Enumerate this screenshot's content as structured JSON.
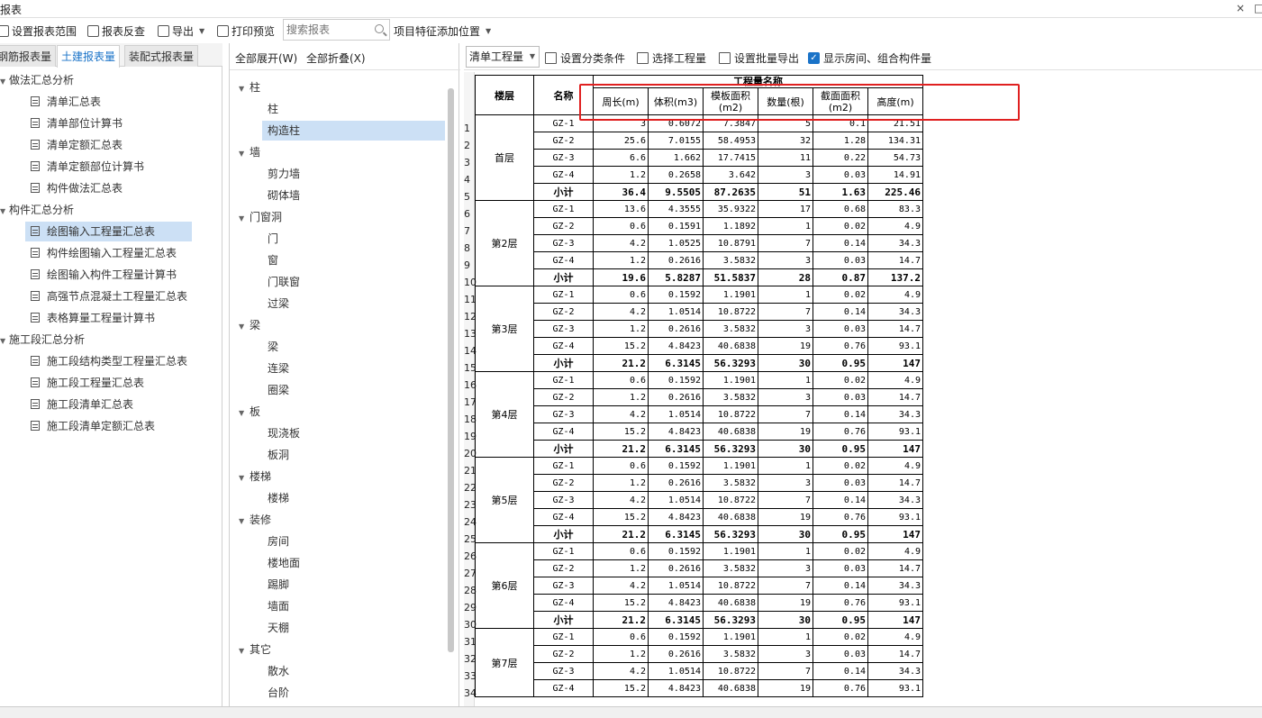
{
  "window": {
    "title": "报表",
    "close_glyph": "×",
    "restore_glyph": "□"
  },
  "toolbar": {
    "set_range": "设置报表范围",
    "reverse": "报表反查",
    "export": "导出",
    "print_preview": "打印预览",
    "search_placeholder": "搜索报表",
    "add_feature_position": "项目特征添加位置"
  },
  "left_tabs": [
    "钢筋报表量",
    "土建报表量",
    "装配式报表量"
  ],
  "left_tree": [
    {
      "type": "group",
      "label": "做法汇总分析"
    },
    {
      "type": "item",
      "label": "清单汇总表"
    },
    {
      "type": "item",
      "label": "清单部位计算书"
    },
    {
      "type": "item",
      "label": "清单定额汇总表"
    },
    {
      "type": "item",
      "label": "清单定额部位计算书"
    },
    {
      "type": "item",
      "label": "构件做法汇总表"
    },
    {
      "type": "group",
      "label": "构件汇总分析"
    },
    {
      "type": "item",
      "label": "绘图输入工程量汇总表",
      "selected": true
    },
    {
      "type": "item",
      "label": "构件绘图输入工程量汇总表"
    },
    {
      "type": "item",
      "label": "绘图输入构件工程量计算书"
    },
    {
      "type": "item",
      "label": "高强节点混凝土工程量汇总表"
    },
    {
      "type": "item",
      "label": "表格算量工程量计算书"
    },
    {
      "type": "group",
      "label": "施工段汇总分析"
    },
    {
      "type": "item",
      "label": "施工段结构类型工程量汇总表"
    },
    {
      "type": "item",
      "label": "施工段工程量汇总表"
    },
    {
      "type": "item",
      "label": "施工段清单汇总表"
    },
    {
      "type": "item",
      "label": "施工段清单定额汇总表"
    }
  ],
  "mid_head": {
    "expand_all": "全部展开(W)",
    "collapse_all": "全部折叠(X)"
  },
  "mid_tree": [
    {
      "type": "group",
      "label": "柱"
    },
    {
      "type": "item",
      "label": "柱"
    },
    {
      "type": "item",
      "label": "构造柱",
      "selected": true
    },
    {
      "type": "group",
      "label": "墙"
    },
    {
      "type": "item",
      "label": "剪力墙"
    },
    {
      "type": "item",
      "label": "砌体墙"
    },
    {
      "type": "group",
      "label": "门窗洞"
    },
    {
      "type": "item",
      "label": "门"
    },
    {
      "type": "item",
      "label": "窗"
    },
    {
      "type": "item",
      "label": "门联窗"
    },
    {
      "type": "item",
      "label": "过梁"
    },
    {
      "type": "group",
      "label": "梁"
    },
    {
      "type": "item",
      "label": "梁"
    },
    {
      "type": "item",
      "label": "连梁"
    },
    {
      "type": "item",
      "label": "圈梁"
    },
    {
      "type": "group",
      "label": "板"
    },
    {
      "type": "item",
      "label": "现浇板"
    },
    {
      "type": "item",
      "label": "板洞"
    },
    {
      "type": "group",
      "label": "楼梯"
    },
    {
      "type": "item",
      "label": "楼梯"
    },
    {
      "type": "group",
      "label": "装修"
    },
    {
      "type": "item",
      "label": "房间"
    },
    {
      "type": "item",
      "label": "楼地面"
    },
    {
      "type": "item",
      "label": "踢脚"
    },
    {
      "type": "item",
      "label": "墙面"
    },
    {
      "type": "item",
      "label": "天棚"
    },
    {
      "type": "group",
      "label": "其它"
    },
    {
      "type": "item",
      "label": "散水"
    },
    {
      "type": "item",
      "label": "台阶"
    }
  ],
  "right_toolbar": {
    "filter_value": "清单工程量",
    "set_category": "设置分类条件",
    "select_project": "选择工程量",
    "batch_export": "设置批量导出",
    "show_rooms": "显示房间、组合构件量"
  },
  "table": {
    "head": {
      "floor": "楼层",
      "name": "名称",
      "group": "工程量名称",
      "cols": [
        "周长(m)",
        "体积(m3)",
        "模板面积(m2)",
        "数量(根)",
        "截面面积(m2)",
        "高度(m)"
      ]
    },
    "floors": [
      {
        "floor": "首层",
        "rows": [
          [
            "GZ-1",
            "3",
            "0.6072",
            "7.3847",
            "5",
            "0.1",
            "21.51"
          ],
          [
            "GZ-2",
            "25.6",
            "7.0155",
            "58.4953",
            "32",
            "1.28",
            "134.31"
          ],
          [
            "GZ-3",
            "6.6",
            "1.662",
            "17.7415",
            "11",
            "0.22",
            "54.73"
          ],
          [
            "GZ-4",
            "1.2",
            "0.2658",
            "3.642",
            "3",
            "0.03",
            "14.91"
          ],
          [
            "小计",
            "36.4",
            "9.5505",
            "87.2635",
            "51",
            "1.63",
            "225.46"
          ]
        ]
      },
      {
        "floor": "第2层",
        "rows": [
          [
            "GZ-1",
            "13.6",
            "4.3555",
            "35.9322",
            "17",
            "0.68",
            "83.3"
          ],
          [
            "GZ-2",
            "0.6",
            "0.1591",
            "1.1892",
            "1",
            "0.02",
            "4.9"
          ],
          [
            "GZ-3",
            "4.2",
            "1.0525",
            "10.8791",
            "7",
            "0.14",
            "34.3"
          ],
          [
            "GZ-4",
            "1.2",
            "0.2616",
            "3.5832",
            "3",
            "0.03",
            "14.7"
          ],
          [
            "小计",
            "19.6",
            "5.8287",
            "51.5837",
            "28",
            "0.87",
            "137.2"
          ]
        ]
      },
      {
        "floor": "第3层",
        "rows": [
          [
            "GZ-1",
            "0.6",
            "0.1592",
            "1.1901",
            "1",
            "0.02",
            "4.9"
          ],
          [
            "GZ-2",
            "4.2",
            "1.0514",
            "10.8722",
            "7",
            "0.14",
            "34.3"
          ],
          [
            "GZ-3",
            "1.2",
            "0.2616",
            "3.5832",
            "3",
            "0.03",
            "14.7"
          ],
          [
            "GZ-4",
            "15.2",
            "4.8423",
            "40.6838",
            "19",
            "0.76",
            "93.1"
          ],
          [
            "小计",
            "21.2",
            "6.3145",
            "56.3293",
            "30",
            "0.95",
            "147"
          ]
        ]
      },
      {
        "floor": "第4层",
        "rows": [
          [
            "GZ-1",
            "0.6",
            "0.1592",
            "1.1901",
            "1",
            "0.02",
            "4.9"
          ],
          [
            "GZ-2",
            "1.2",
            "0.2616",
            "3.5832",
            "3",
            "0.03",
            "14.7"
          ],
          [
            "GZ-3",
            "4.2",
            "1.0514",
            "10.8722",
            "7",
            "0.14",
            "34.3"
          ],
          [
            "GZ-4",
            "15.2",
            "4.8423",
            "40.6838",
            "19",
            "0.76",
            "93.1"
          ],
          [
            "小计",
            "21.2",
            "6.3145",
            "56.3293",
            "30",
            "0.95",
            "147"
          ]
        ]
      },
      {
        "floor": "第5层",
        "rows": [
          [
            "GZ-1",
            "0.6",
            "0.1592",
            "1.1901",
            "1",
            "0.02",
            "4.9"
          ],
          [
            "GZ-2",
            "1.2",
            "0.2616",
            "3.5832",
            "3",
            "0.03",
            "14.7"
          ],
          [
            "GZ-3",
            "4.2",
            "1.0514",
            "10.8722",
            "7",
            "0.14",
            "34.3"
          ],
          [
            "GZ-4",
            "15.2",
            "4.8423",
            "40.6838",
            "19",
            "0.76",
            "93.1"
          ],
          [
            "小计",
            "21.2",
            "6.3145",
            "56.3293",
            "30",
            "0.95",
            "147"
          ]
        ]
      },
      {
        "floor": "第6层",
        "rows": [
          [
            "GZ-1",
            "0.6",
            "0.1592",
            "1.1901",
            "1",
            "0.02",
            "4.9"
          ],
          [
            "GZ-2",
            "1.2",
            "0.2616",
            "3.5832",
            "3",
            "0.03",
            "14.7"
          ],
          [
            "GZ-3",
            "4.2",
            "1.0514",
            "10.8722",
            "7",
            "0.14",
            "34.3"
          ],
          [
            "GZ-4",
            "15.2",
            "4.8423",
            "40.6838",
            "19",
            "0.76",
            "93.1"
          ],
          [
            "小计",
            "21.2",
            "6.3145",
            "56.3293",
            "30",
            "0.95",
            "147"
          ]
        ]
      },
      {
        "floor": "第7层",
        "rows": [
          [
            "GZ-1",
            "0.6",
            "0.1592",
            "1.1901",
            "1",
            "0.02",
            "4.9"
          ],
          [
            "GZ-2",
            "1.2",
            "0.2616",
            "3.5832",
            "3",
            "0.03",
            "14.7"
          ],
          [
            "GZ-3",
            "4.2",
            "1.0514",
            "10.8722",
            "7",
            "0.14",
            "34.3"
          ],
          [
            "GZ-4",
            "15.2",
            "4.8423",
            "40.6838",
            "19",
            "0.76",
            "93.1"
          ]
        ]
      }
    ]
  },
  "row_numbers": [
    "1",
    "2",
    "3",
    "4",
    "5",
    "6",
    "7",
    "8",
    "9",
    "10",
    "11",
    "12",
    "13",
    "14",
    "15",
    "16",
    "17",
    "18",
    "19",
    "20",
    "21",
    "22",
    "23",
    "24",
    "25",
    "26",
    "27",
    "28",
    "29",
    "30",
    "31",
    "32",
    "33",
    "34"
  ],
  "colors": {
    "accent": "#1a73c8",
    "selected_bg": "#cce0f5",
    "highlight": "#e02020"
  }
}
